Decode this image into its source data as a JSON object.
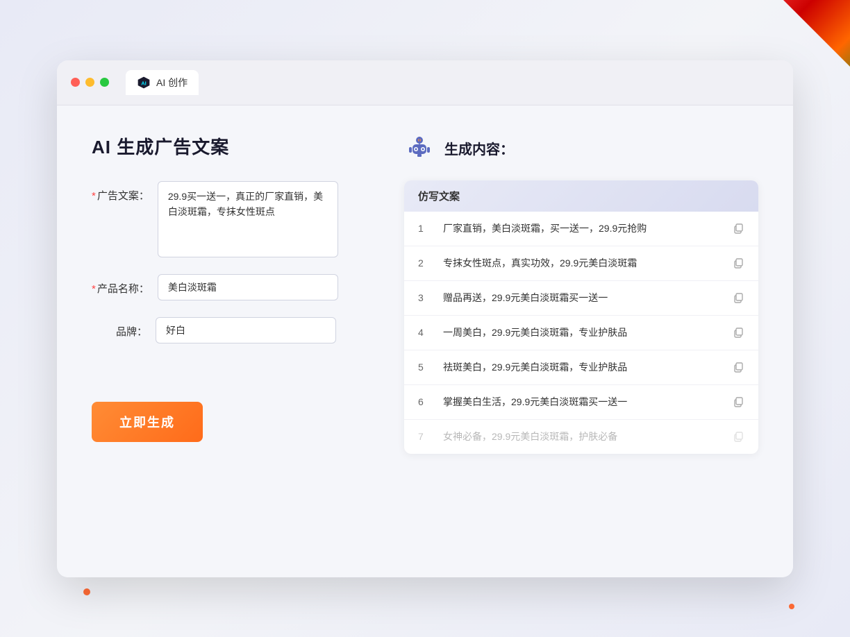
{
  "window": {
    "tab_label": "AI 创作"
  },
  "page": {
    "title": "AI 生成广告文案",
    "right_title": "生成内容："
  },
  "form": {
    "ad_copy_label": "广告文案：",
    "ad_copy_required": "*",
    "ad_copy_value": "29.9买一送一，真正的厂家直销，美白淡斑霜，专抹女性斑点",
    "product_name_label": "产品名称：",
    "product_name_required": "*",
    "product_name_value": "美白淡斑霜",
    "brand_label": "品牌：",
    "brand_value": "好白",
    "generate_button": "立即生成"
  },
  "results": {
    "column_header": "仿写文案",
    "items": [
      {
        "num": "1",
        "text": "厂家直销，美白淡斑霜，买一送一，29.9元抢购",
        "faded": false
      },
      {
        "num": "2",
        "text": "专抹女性斑点，真实功效，29.9元美白淡斑霜",
        "faded": false
      },
      {
        "num": "3",
        "text": "赠品再送，29.9元美白淡斑霜买一送一",
        "faded": false
      },
      {
        "num": "4",
        "text": "一周美白，29.9元美白淡斑霜，专业护肤品",
        "faded": false
      },
      {
        "num": "5",
        "text": "祛斑美白，29.9元美白淡斑霜，专业护肤品",
        "faded": false
      },
      {
        "num": "6",
        "text": "掌握美白生活，29.9元美白淡斑霜买一送一",
        "faded": false
      },
      {
        "num": "7",
        "text": "女神必备，29.9元美白淡斑霜，护肤必备",
        "faded": true
      }
    ]
  }
}
